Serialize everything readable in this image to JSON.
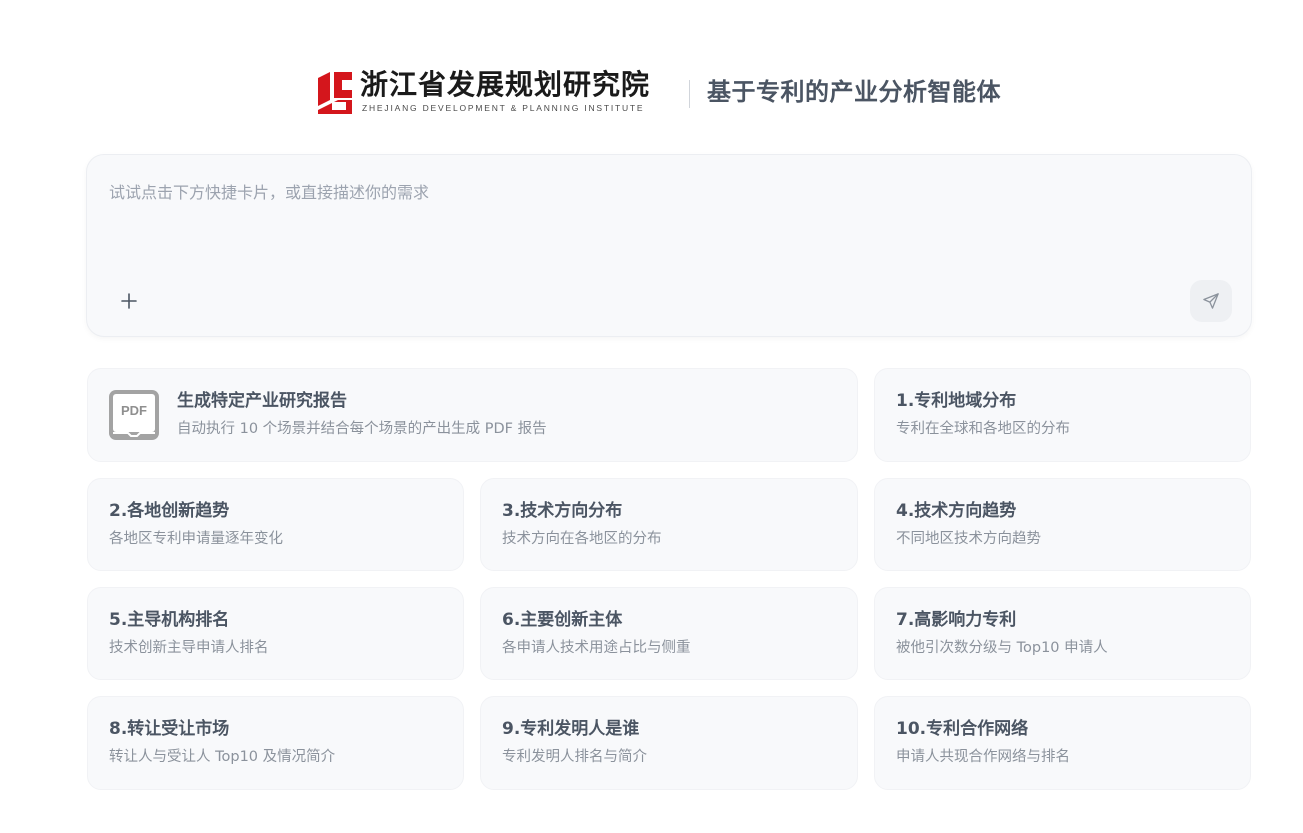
{
  "header": {
    "logo_name_cn": "浙江省发展规划研究院",
    "logo_name_en": "ZHEJIANG DEVELOPMENT & PLANNING INSTITUTE",
    "subtitle": "基于专利的产业分析智能体"
  },
  "prompt": {
    "placeholder": "试试点击下方快捷卡片，或直接描述你的需求",
    "value": "",
    "add_icon": "plus-icon",
    "send_icon": "send-icon"
  },
  "cards": {
    "report": {
      "icon": "pdf-icon",
      "icon_label": "PDF",
      "title": "生成特定产业研究报告",
      "desc": "自动执行 10 个场景并结合每个场景的产出生成 PDF 报告"
    },
    "items": [
      {
        "title": "1.专利地域分布",
        "desc": "专利在全球和各地区的分布"
      },
      {
        "title": "2.各地创新趋势",
        "desc": "各地区专利申请量逐年变化"
      },
      {
        "title": "3.技术方向分布",
        "desc": "技术方向在各地区的分布"
      },
      {
        "title": "4.技术方向趋势",
        "desc": "不同地区技术方向趋势"
      },
      {
        "title": "5.主导机构排名",
        "desc": "技术创新主导申请人排名"
      },
      {
        "title": "6.主要创新主体",
        "desc": "各申请人技术用途占比与侧重"
      },
      {
        "title": "7.高影响力专利",
        "desc": "被他引次数分级与 Top10 申请人"
      },
      {
        "title": "8.转让受让市场",
        "desc": "转让人与受让人 Top10 及情况简介"
      },
      {
        "title": "9.专利发明人是谁",
        "desc": "专利发明人排名与简介"
      },
      {
        "title": "10.专利合作网络",
        "desc": "申请人共现合作网络与排名"
      }
    ]
  },
  "colors": {
    "logo_red": "#d4161c",
    "card_bg": "#f8f9fb",
    "title_text": "#4b5563",
    "desc_text": "#8b929c"
  }
}
